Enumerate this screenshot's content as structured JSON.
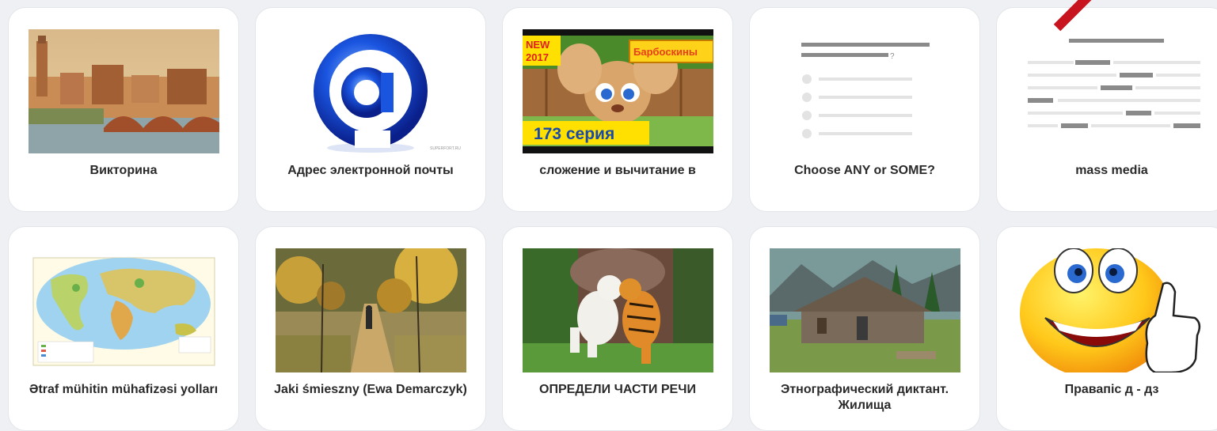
{
  "cards": [
    {
      "title": "Викторина",
      "thumb": "verona-painting"
    },
    {
      "title": "Адрес электронной почты",
      "thumb": "at-sign-icon"
    },
    {
      "title": "сложение и вычитание в",
      "thumb": "cartoon-video",
      "badge_new": "NEW",
      "badge_year": "2017",
      "brand": "Барбоскины",
      "episode": "173 серия"
    },
    {
      "title": "Choose ANY or SOME?",
      "thumb": "quiz-template"
    },
    {
      "title": "mass media",
      "thumb": "text-template"
    },
    {
      "title": "Ətraf mühitin mühafizəsi yolları",
      "thumb": "world-map"
    },
    {
      "title": "Jaki śmieszny (Ewa Demarczyk)",
      "thumb": "autumn-painting"
    },
    {
      "title": "ОПРЕДЕЛИ ЧАСТИ РЕЧИ",
      "thumb": "lion-tiger-photo"
    },
    {
      "title": "Этнографический диктант. Жилища",
      "thumb": "hut-photo"
    },
    {
      "title": "Правапіс д - дз",
      "thumb": "smiley-thumbs-up"
    }
  ],
  "colors": {
    "accent_arrow": "#c8141e",
    "card_bg": "#ffffff",
    "page_bg": "#eef0f3"
  }
}
